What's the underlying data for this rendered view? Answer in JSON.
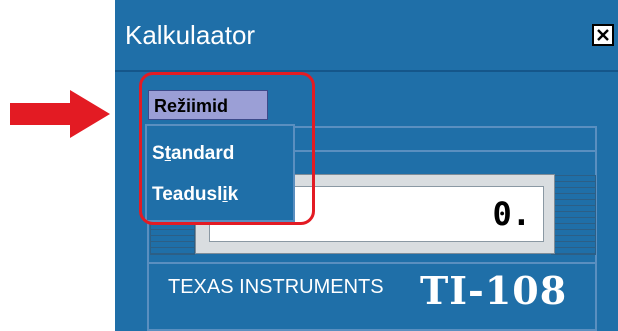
{
  "window": {
    "title": "Kalkulaator"
  },
  "menu": {
    "label": "Režiimid",
    "items": [
      {
        "label": "Standard",
        "mnemonic": "t"
      },
      {
        "label": "Teaduslik",
        "mnemonic": "i"
      }
    ]
  },
  "display": {
    "value": "0."
  },
  "brand": {
    "manufacturer": "TEXAS INSTRUMENTS",
    "model": "TI-108"
  },
  "colors": {
    "window": "#1f6fa8",
    "menu_tab": "#9b9fd6",
    "highlight": "#e31b23",
    "arrow": "#e31b23"
  },
  "icons": {
    "close": "close-icon",
    "pointer": "arrow-right-icon"
  }
}
